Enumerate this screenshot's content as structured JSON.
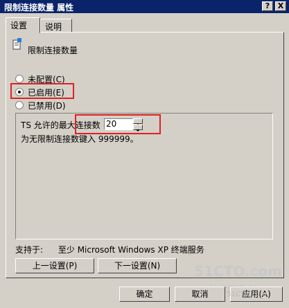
{
  "window": {
    "title": "限制连接数量 属性",
    "help_btn": "?",
    "close_btn": "X"
  },
  "tabs": [
    {
      "label": "设置"
    },
    {
      "label": "说明"
    }
  ],
  "policy": {
    "name": "限制连接数量"
  },
  "radios": [
    {
      "label": "未配置(C)",
      "selected": false
    },
    {
      "label": "已启用(E)",
      "selected": true
    },
    {
      "label": "已禁用(D)",
      "selected": false
    }
  ],
  "options": {
    "max_label": "TS 允许的最大连接数",
    "max_value": "20",
    "hint": "为无限制连接数键入 999999。"
  },
  "supported": {
    "label": "支持于:",
    "value": "至少 Microsoft Windows XP 终端服务"
  },
  "nav": {
    "prev": "上一设置(P)",
    "next": "下一设置(N)"
  },
  "footer": {
    "ok": "确定",
    "cancel": "取消",
    "apply": "应用(A)"
  },
  "watermark": {
    "site": "51CTO.com",
    "sub1": "技术博客 Blog",
    "sub2": "51CTO.com"
  },
  "colors": {
    "titlebar": "#0a246a",
    "dialog_bg": "#d4d0c8",
    "highlight": "#e02020"
  }
}
